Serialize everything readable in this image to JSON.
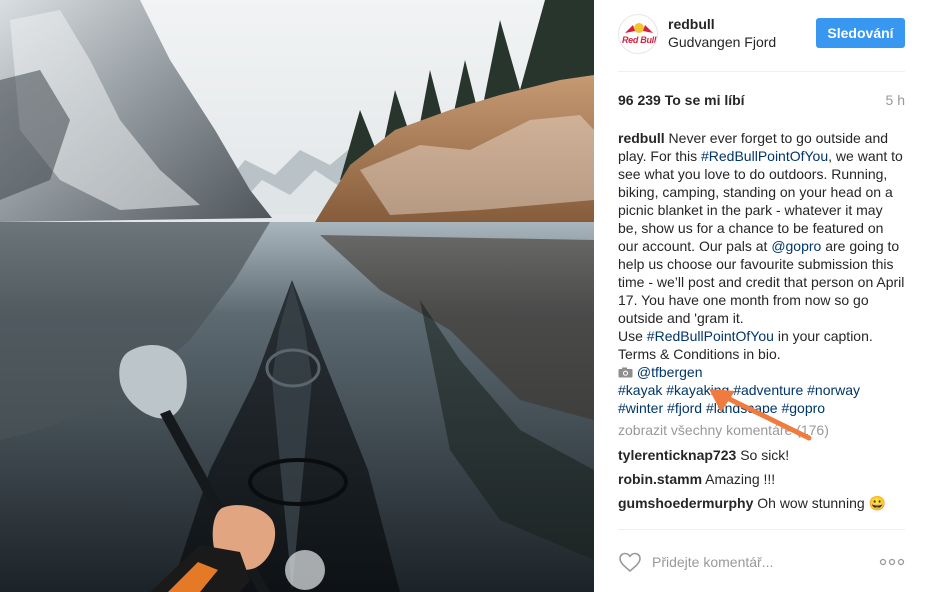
{
  "post": {
    "username": "redbull",
    "location": "Gudvangen Fjord",
    "follow_label": "Sledování",
    "avatar_text": "Red Bull",
    "likes": "96 239 To se mi líbí",
    "time": "5 h"
  },
  "caption": {
    "author": "redbull",
    "p1": " Never ever forget to go outside and play. For this ",
    "tag1": "#RedBullPointOfYou",
    "p2": ", we want to see what you love to do outdoors. Running, biking, camping, standing on your head on a picnic blanket in the park - whatever it may be, show us for a chance to be featured on our account. Our pals at ",
    "mention1": "@gopro",
    "p3": " are going to help us choose our favourite submission this time - we’ll post and credit that person on April 17. You have one month from now so go outside and 'gram it.",
    "p4": "Use ",
    "tag2": "#RedBullPointOfYou",
    "p5": " in your caption.",
    "p6": "Terms & Conditions in bio.",
    "mention2": "@tfbergen",
    "hashtags": [
      "#kayak",
      "#kayaking",
      "#adventure",
      "#norway",
      "#winter",
      "#fjord",
      "#landscape",
      "#gopro"
    ]
  },
  "view_all": "zobrazit všechny komentáře (176)",
  "comments": [
    {
      "author": "tylerenticknap723",
      "text": "So sick!"
    },
    {
      "author": "robin.stamm",
      "text": "Amazing !!!"
    },
    {
      "author": "gumshoedermurphy",
      "text": "Oh wow stunning 😀"
    }
  ],
  "footer": {
    "placeholder": "Přidejte komentář..."
  },
  "colors": {
    "accent": "#3897f0",
    "hashtag": "#003569",
    "annotation": "#f07b3f"
  }
}
